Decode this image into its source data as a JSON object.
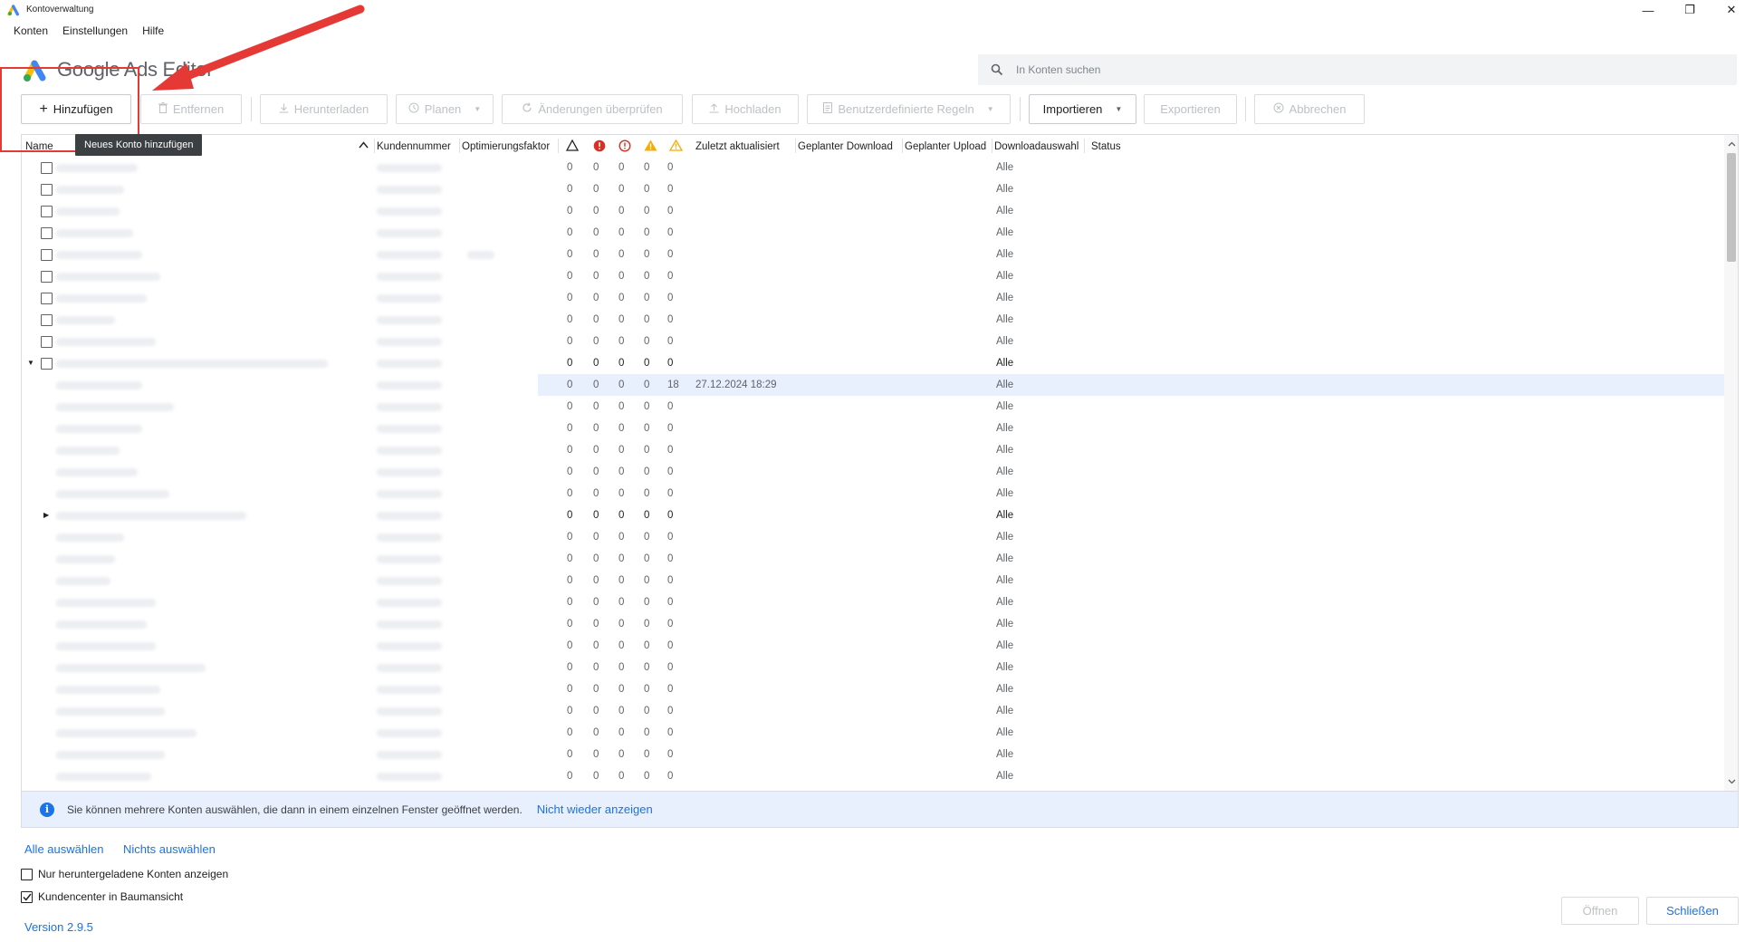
{
  "window": {
    "title": "Kontoverwaltung",
    "controls": {
      "minimize": "—",
      "maximize": "❐",
      "close": "✕"
    }
  },
  "menu": [
    "Konten",
    "Einstellungen",
    "Hilfe"
  ],
  "app": {
    "name": "Google Ads Editor"
  },
  "search": {
    "placeholder": "In Konten suchen",
    "value": ""
  },
  "toolbar": {
    "add": "Hinzufügen",
    "remove": "Entfernen",
    "download": "Herunterladen",
    "schedule": "Planen",
    "review": "Änderungen überprüfen",
    "upload": "Hochladen",
    "custom_rules": "Benutzerdefinierte Regeln",
    "import": "Importieren",
    "export": "Exportieren",
    "cancel": "Abbrechen"
  },
  "tooltip": "Neues Konto hinzufügen",
  "table": {
    "columns": {
      "name": "Name",
      "customer_id": "Kundennummer",
      "optimization": "Optimierungsfaktor",
      "last_updated": "Zuletzt aktualisiert",
      "scheduled_download": "Geplanter Download",
      "scheduled_upload": "Geplanter Upload",
      "download_selection": "Downloadauswahl",
      "status": "Status"
    },
    "rows": [
      {
        "a": "0",
        "b": "0",
        "c": "0",
        "d": "0",
        "e": "0",
        "sel": "Alle",
        "date": "",
        "checkbox": true,
        "level": 0
      },
      {
        "a": "0",
        "b": "0",
        "c": "0",
        "d": "0",
        "e": "0",
        "sel": "Alle",
        "date": "",
        "checkbox": true,
        "level": 0
      },
      {
        "a": "0",
        "b": "0",
        "c": "0",
        "d": "0",
        "e": "0",
        "sel": "Alle",
        "date": "",
        "checkbox": true,
        "level": 0
      },
      {
        "a": "0",
        "b": "0",
        "c": "0",
        "d": "0",
        "e": "0",
        "sel": "Alle",
        "date": "",
        "checkbox": true,
        "level": 0
      },
      {
        "a": "0",
        "b": "0",
        "c": "0",
        "d": "0",
        "e": "0",
        "sel": "Alle",
        "date": "",
        "checkbox": true,
        "level": 0
      },
      {
        "a": "0",
        "b": "0",
        "c": "0",
        "d": "0",
        "e": "0",
        "sel": "Alle",
        "date": "",
        "checkbox": true,
        "level": 0
      },
      {
        "a": "0",
        "b": "0",
        "c": "0",
        "d": "0",
        "e": "0",
        "sel": "Alle",
        "date": "",
        "checkbox": true,
        "level": 0
      },
      {
        "a": "0",
        "b": "0",
        "c": "0",
        "d": "0",
        "e": "0",
        "sel": "Alle",
        "date": "",
        "checkbox": true,
        "level": 0
      },
      {
        "a": "0",
        "b": "0",
        "c": "0",
        "d": "0",
        "e": "0",
        "sel": "Alle",
        "date": "",
        "checkbox": true,
        "level": 0
      },
      {
        "a": "0",
        "b": "0",
        "c": "0",
        "d": "0",
        "e": "0",
        "sel": "Alle",
        "date": "",
        "checkbox": true,
        "level": 0,
        "expanded": true,
        "bold": true
      },
      {
        "a": "0",
        "b": "0",
        "c": "0",
        "d": "0",
        "e": "18",
        "sel": "Alle",
        "date": "27.12.2024 18:29",
        "checkbox": false,
        "level": 1,
        "selected": true
      },
      {
        "a": "0",
        "b": "0",
        "c": "0",
        "d": "0",
        "e": "0",
        "sel": "Alle",
        "date": "",
        "checkbox": false,
        "level": 1
      },
      {
        "a": "0",
        "b": "0",
        "c": "0",
        "d": "0",
        "e": "0",
        "sel": "Alle",
        "date": "",
        "checkbox": false,
        "level": 1
      },
      {
        "a": "0",
        "b": "0",
        "c": "0",
        "d": "0",
        "e": "0",
        "sel": "Alle",
        "date": "",
        "checkbox": false,
        "level": 1
      },
      {
        "a": "0",
        "b": "0",
        "c": "0",
        "d": "0",
        "e": "0",
        "sel": "Alle",
        "date": "",
        "checkbox": false,
        "level": 1
      },
      {
        "a": "0",
        "b": "0",
        "c": "0",
        "d": "0",
        "e": "0",
        "sel": "Alle",
        "date": "",
        "checkbox": false,
        "level": 1
      },
      {
        "a": "0",
        "b": "0",
        "c": "0",
        "d": "0",
        "e": "0",
        "sel": "Alle",
        "date": "",
        "checkbox": false,
        "level": 1,
        "collapsed": true,
        "bold": true
      },
      {
        "a": "0",
        "b": "0",
        "c": "0",
        "d": "0",
        "e": "0",
        "sel": "Alle",
        "date": "",
        "checkbox": false,
        "level": 1
      },
      {
        "a": "0",
        "b": "0",
        "c": "0",
        "d": "0",
        "e": "0",
        "sel": "Alle",
        "date": "",
        "checkbox": false,
        "level": 1
      },
      {
        "a": "0",
        "b": "0",
        "c": "0",
        "d": "0",
        "e": "0",
        "sel": "Alle",
        "date": "",
        "checkbox": false,
        "level": 1
      },
      {
        "a": "0",
        "b": "0",
        "c": "0",
        "d": "0",
        "e": "0",
        "sel": "Alle",
        "date": "",
        "checkbox": false,
        "level": 1
      },
      {
        "a": "0",
        "b": "0",
        "c": "0",
        "d": "0",
        "e": "0",
        "sel": "Alle",
        "date": "",
        "checkbox": false,
        "level": 1
      },
      {
        "a": "0",
        "b": "0",
        "c": "0",
        "d": "0",
        "e": "0",
        "sel": "Alle",
        "date": "",
        "checkbox": false,
        "level": 1
      },
      {
        "a": "0",
        "b": "0",
        "c": "0",
        "d": "0",
        "e": "0",
        "sel": "Alle",
        "date": "",
        "checkbox": false,
        "level": 1
      },
      {
        "a": "0",
        "b": "0",
        "c": "0",
        "d": "0",
        "e": "0",
        "sel": "Alle",
        "date": "",
        "checkbox": false,
        "level": 1
      },
      {
        "a": "0",
        "b": "0",
        "c": "0",
        "d": "0",
        "e": "0",
        "sel": "Alle",
        "date": "",
        "checkbox": false,
        "level": 1
      },
      {
        "a": "0",
        "b": "0",
        "c": "0",
        "d": "0",
        "e": "0",
        "sel": "Alle",
        "date": "",
        "checkbox": false,
        "level": 1
      },
      {
        "a": "0",
        "b": "0",
        "c": "0",
        "d": "0",
        "e": "0",
        "sel": "Alle",
        "date": "",
        "checkbox": false,
        "level": 1
      },
      {
        "a": "0",
        "b": "0",
        "c": "0",
        "d": "0",
        "e": "0",
        "sel": "Alle",
        "date": "",
        "checkbox": false,
        "level": 1
      },
      {
        "a": "0",
        "b": "0",
        "c": "0",
        "d": "0",
        "e": "0",
        "sel": "Alle",
        "date": "",
        "checkbox": false,
        "level": 1
      }
    ]
  },
  "banner": {
    "text": "Sie können mehrere Konten auswählen, die dann in einem einzelnen Fenster geöffnet werden.",
    "link": "Nicht wieder anzeigen"
  },
  "bottom": {
    "select_all": "Alle auswählen",
    "select_none": "Nichts auswählen",
    "only_downloaded": "Nur heruntergeladene Konten anzeigen",
    "only_downloaded_checked": false,
    "tree_view": "Kundencenter in Baumansicht",
    "tree_view_checked": true,
    "version": "Version 2.9.5",
    "open": "Öffnen",
    "close": "Schließen"
  },
  "colors": {
    "accent": "#1a73e8",
    "error": "#d93025",
    "warning": "#f9ab00",
    "annotation": "#e53935"
  }
}
